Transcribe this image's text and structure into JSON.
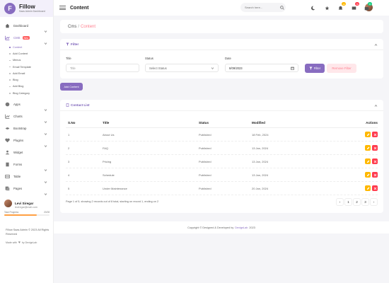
{
  "brand": {
    "logo_letter": "F",
    "title": "Fillow",
    "subtitle": "Saas Admin Dashboard"
  },
  "sidebar": {
    "items": [
      {
        "label": "Dashboard",
        "icon": "home-icon"
      },
      {
        "label": "CMS",
        "icon": "chart-icon",
        "badge": "New"
      },
      {
        "label": "Apps",
        "icon": "info-icon"
      },
      {
        "label": "Charts",
        "icon": "line-chart-icon"
      },
      {
        "label": "Bootstrap",
        "icon": "bootstrap-icon"
      },
      {
        "label": "Plugins",
        "icon": "heart-icon"
      },
      {
        "label": "Widget",
        "icon": "user-icon"
      },
      {
        "label": "Forms",
        "icon": "file-icon"
      },
      {
        "label": "Table",
        "icon": "table-icon"
      },
      {
        "label": "Pages",
        "icon": "pages-icon"
      }
    ],
    "cms_sub": [
      "Content",
      "Add Content",
      "Menus",
      "Email Template",
      "Add Email",
      "Blog",
      "Add Blog",
      "Blog Category"
    ]
  },
  "profile": {
    "name": "Levi Siregar",
    "email": "leviregar@mail.com",
    "progress_label": "Task Progress",
    "progress_value": "20/28",
    "progress_fraction": 0.714
  },
  "side_footer": {
    "copyright": "Fillow Saas Admin © 2023 All Rights Reserved",
    "made_with_a": "Made with",
    "made_with_b": "by DexignLab"
  },
  "header": {
    "title": "Content",
    "search_placeholder": "Search here...",
    "badges": [
      "12",
      "76",
      "8"
    ]
  },
  "breadcrumb": {
    "parent": "Cms",
    "sep": "/",
    "current": "Content"
  },
  "filter": {
    "heading": "Filter",
    "title_label": "Title",
    "title_placeholder": "Title",
    "status_label": "Status",
    "status_value": "Select Status",
    "date_label": "Date",
    "date_value": "8/09/2023",
    "filter_btn": "Filter",
    "remove_btn": "Remove Filter"
  },
  "add_content_btn": "Add Content",
  "list": {
    "heading": "Contact List",
    "columns": {
      "sno": "S.No",
      "title": "Title",
      "status": "Status",
      "modified": "Modified",
      "actions": "Actions"
    },
    "rows": [
      {
        "sno": "1",
        "title": "About Us",
        "status": "Published",
        "modified": "18 Feb, 2024"
      },
      {
        "sno": "2",
        "title": "FAQ",
        "status": "Published",
        "modified": "13 Jan, 2024"
      },
      {
        "sno": "3",
        "title": "Pricing",
        "status": "Published",
        "modified": "13 Jan, 2024"
      },
      {
        "sno": "4",
        "title": "Schedule",
        "status": "Published",
        "modified": "13 Jan, 2024"
      },
      {
        "sno": "5",
        "title": "Under Maintenance",
        "status": "Published",
        "modified": "20 Jan, 2024"
      }
    ],
    "pager_info": "Page 1 of 5, showing 2 records out of 8 total, starting on record 1, ending on 2",
    "pages": [
      "‹",
      "1",
      "2",
      "3",
      "›"
    ]
  },
  "footer": {
    "text": "Copyright © Designed & Developed by",
    "link": "DexignLab",
    "year": "2023"
  },
  "colors": {
    "primary": "#886cc0",
    "accent": "#ff7f8e",
    "edit": "#ffb800",
    "delete": "#ff3c4e"
  }
}
